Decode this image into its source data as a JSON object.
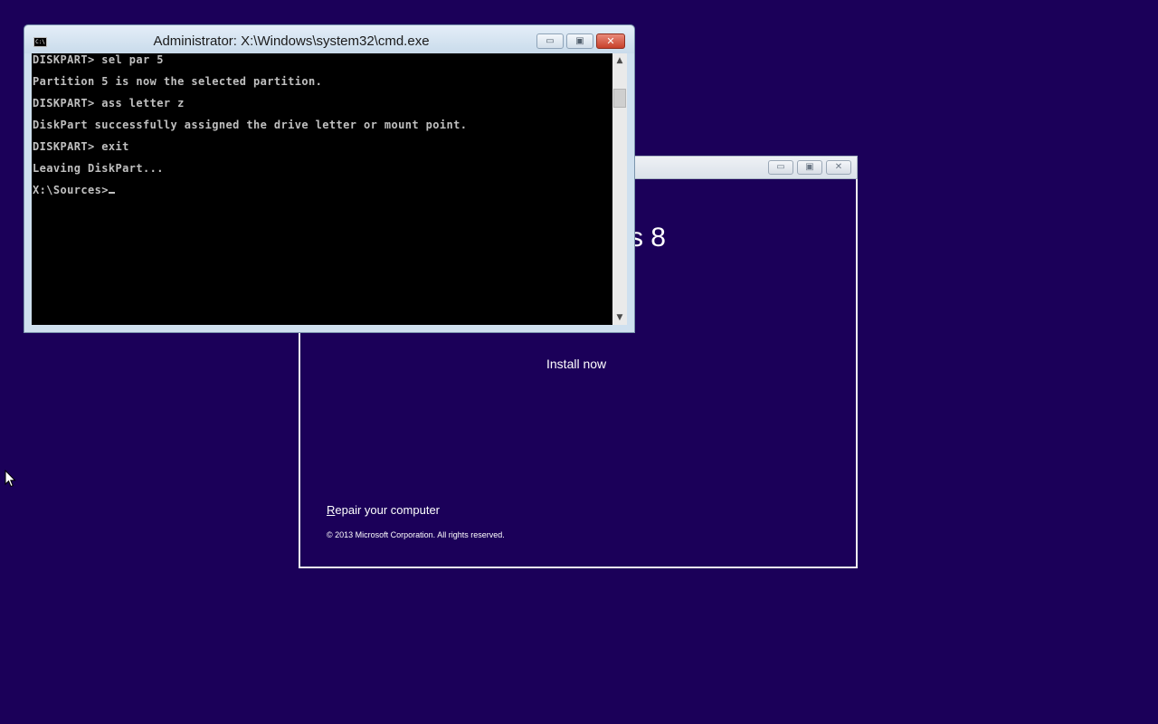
{
  "setup_window": {
    "product_title": "s 8",
    "install_now": "Install now",
    "repair_first_letter": "R",
    "repair_rest": "epair your computer",
    "copyright": "© 2013 Microsoft Corporation. All rights reserved.",
    "buttons": {
      "minimize": "▭",
      "maximize": "▣",
      "close": "✕"
    }
  },
  "cmd_window": {
    "title": "Administrator: X:\\Windows\\system32\\cmd.exe",
    "icon_text": "C:\\",
    "buttons": {
      "minimize": "▭",
      "maximize": "▣",
      "close": "✕"
    },
    "lines": [
      "DISKPART> sel par 5",
      "Partition 5 is now the selected partition.",
      "DISKPART> ass letter z",
      "DiskPart successfully assigned the drive letter or mount point.",
      "DISKPART> exit",
      "Leaving DiskPart...",
      "X:\\Sources>"
    ],
    "scrollbar": {
      "up": "▲",
      "down": "▼"
    }
  },
  "colors": {
    "desktop_background": "#1b0059",
    "console_background": "#000000",
    "console_text": "#c0c0c0",
    "close_button": "#c7412b"
  }
}
